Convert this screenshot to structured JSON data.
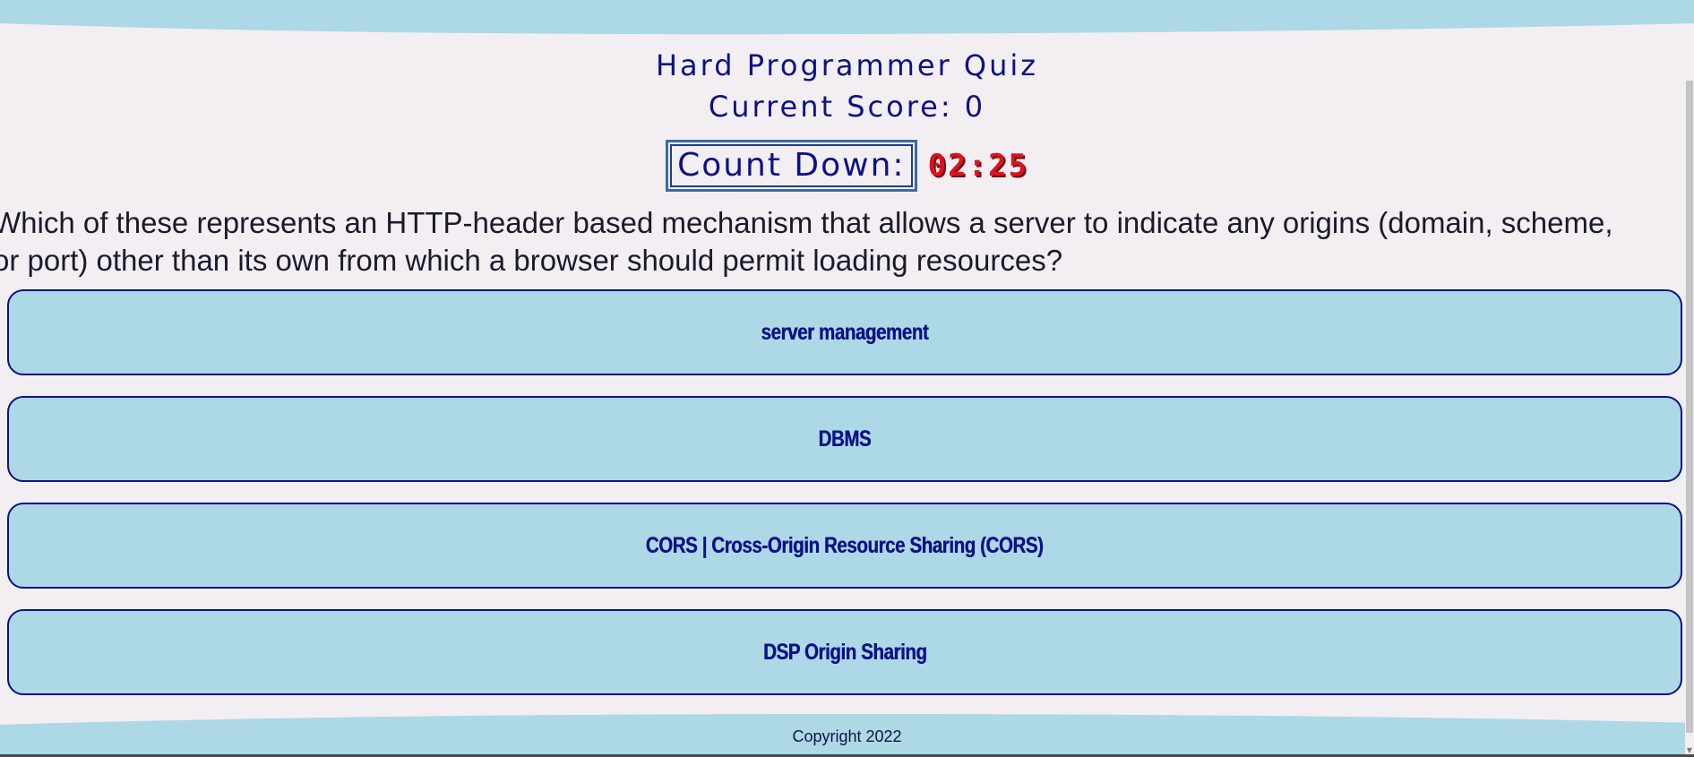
{
  "header": {
    "title": "Hard Programmer Quiz",
    "score": "Current Score: 0"
  },
  "countdown": {
    "label": "Count Down:",
    "time": "02:25"
  },
  "question": {
    "line1": "Which of these represents an HTTP-header based mechanism that allows a server to indicate any origins (domain, scheme,",
    "line2": "or port) other than its own from which a browser should permit loading resources?"
  },
  "answers": [
    {
      "label": "server management"
    },
    {
      "label": "DBMS"
    },
    {
      "label": "CORS | Cross-Origin Resource Sharing (CORS)"
    },
    {
      "label": "DSP Origin Sharing"
    }
  ],
  "footer": {
    "copyright": "Copyright 2022"
  },
  "colors": {
    "background": "#f3eef2",
    "wave": "#add8e6",
    "text_accent": "#0c1187",
    "timer": "#d9141e"
  }
}
